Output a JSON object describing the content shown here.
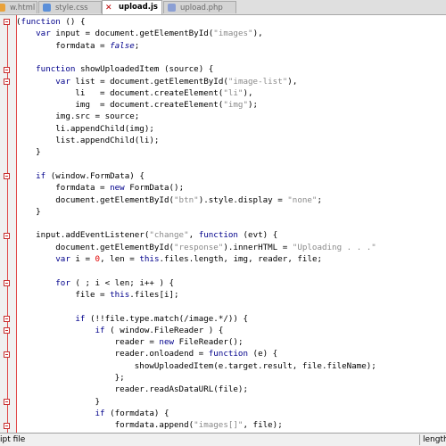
{
  "tabs": [
    {
      "label": "w.html",
      "icon": "html-file-icon",
      "active": false
    },
    {
      "label": "style.css",
      "icon": "css-file-icon",
      "active": false
    },
    {
      "label": "upload.js",
      "icon": "close-tab-icon",
      "active": true
    },
    {
      "label": "upload.php",
      "icon": "php-file-icon",
      "active": false
    }
  ],
  "code": [
    "(function () {",
    "    var input = document.getElementById(\"images\"),",
    "        formdata = false;",
    "",
    "    function showUploadedItem (source) {",
    "        var list = document.getElementById(\"image-list\"),",
    "            li   = document.createElement(\"li\"),",
    "            img  = document.createElement(\"img\");",
    "        img.src = source;",
    "        li.appendChild(img);",
    "        list.appendChild(li);",
    "    }",
    "",
    "    if (window.FormData) {",
    "        formdata = new FormData();",
    "        document.getElementById(\"btn\").style.display = \"none\";",
    "    }",
    "",
    "    input.addEventListener(\"change\", function (evt) {",
    "        document.getElementById(\"response\").innerHTML = \"Uploading . . .\"",
    "        var i = 0, len = this.files.length, img, reader, file;",
    "",
    "        for ( ; i < len; i++ ) {",
    "            file = this.files[i];",
    "",
    "            if (!!file.type.match(/image.*/)) {",
    "                if ( window.FileReader ) {",
    "                    reader = new FileReader();",
    "                    reader.onloadend = function (e) {",
    "                        showUploadedItem(e.target.result, file.fileName);",
    "                    };",
    "                    reader.readAsDataURL(file);",
    "                }",
    "                if (formdata) {",
    "                    formdata.append(\"images[]\", file);",
    "                }"
  ],
  "status": {
    "left": "ipt file",
    "right": "length"
  },
  "colors": {
    "keyword": "#00008b",
    "string": "#8a8a8a",
    "number": "#e00000",
    "fold_marker": "#c82d2d",
    "margin_line": "#e14a4a"
  }
}
